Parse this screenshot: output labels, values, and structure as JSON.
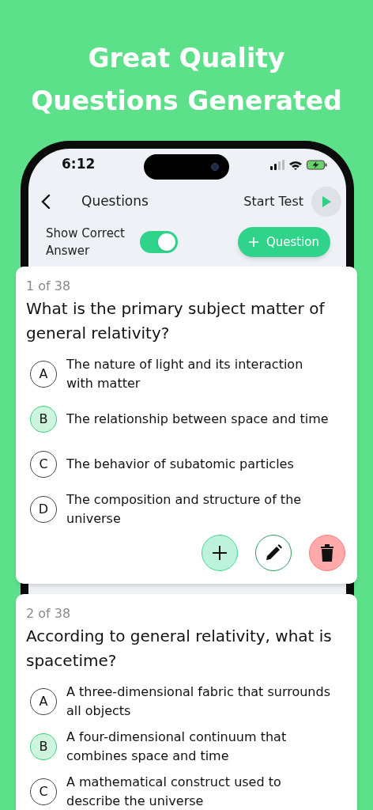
{
  "headline": [
    "Great Quality",
    "Questions Generated"
  ],
  "status_bar": {
    "time": "6:12"
  },
  "header": {
    "title": "Questions",
    "start_label": "Start Test"
  },
  "toggle": {
    "label": "Show Correct Answer",
    "on": true
  },
  "add_button": {
    "label": "Question"
  },
  "questions": [
    {
      "counter": "1 of 38",
      "text": "What is the primary subject matter of general relativity?",
      "options": [
        {
          "letter": "A",
          "text": "The nature of light and its interaction with matter",
          "selected": false
        },
        {
          "letter": "B",
          "text": "The relationship between space and time",
          "selected": true
        },
        {
          "letter": "C",
          "text": "The behavior of subatomic particles",
          "selected": false
        },
        {
          "letter": "D",
          "text": "The composition and structure of the universe",
          "selected": false
        }
      ],
      "actions": [
        {
          "kind": "add"
        },
        {
          "kind": "edit"
        },
        {
          "kind": "delete"
        }
      ]
    },
    {
      "counter": "2 of 38",
      "text": "According to general relativity, what is spacetime?",
      "options": [
        {
          "letter": "A",
          "text": "A three-dimensional fabric that surrounds all objects",
          "selected": false
        },
        {
          "letter": "B",
          "text": "A four-dimensional continuum that combines space and time",
          "selected": true
        },
        {
          "letter": "C",
          "text": "A mathematical construct used to describe the universe",
          "selected": false
        }
      ]
    }
  ]
}
